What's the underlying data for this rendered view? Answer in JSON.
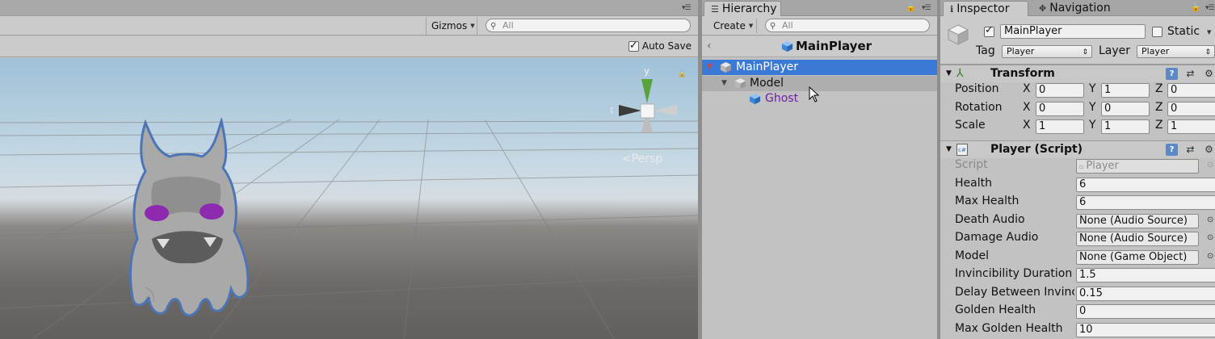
{
  "scene": {
    "gizmos_label": "Gizmos",
    "search_placeholder": "All",
    "autosave_label": "Auto Save",
    "autosave_checked": true,
    "persp_label": "Persp",
    "axis_y": "y",
    "axis_x": "x"
  },
  "hierarchy": {
    "tab_label": "Hierarchy",
    "create_label": "Create",
    "search_placeholder": "All",
    "scene_title": "MainPlayer",
    "tree": [
      {
        "label": "MainPlayer",
        "depth": 0,
        "selected": true,
        "expanded": true
      },
      {
        "label": "Model",
        "depth": 1,
        "selected": false,
        "expanded": true
      },
      {
        "label": "Ghost",
        "depth": 2,
        "selected": false,
        "prefab": true
      }
    ]
  },
  "inspector": {
    "tab_label": "Inspector",
    "nav_tab_label": "Navigation",
    "object_name": "MainPlayer",
    "active_checked": true,
    "static_label": "Static",
    "tag_label": "Tag",
    "tag_value": "Player",
    "layer_label": "Layer",
    "layer_value": "Player",
    "transform": {
      "title": "Transform",
      "rows": [
        {
          "label": "Position",
          "x": "0",
          "y": "1",
          "z": "0"
        },
        {
          "label": "Rotation",
          "x": "0",
          "y": "0",
          "z": "0"
        },
        {
          "label": "Scale",
          "x": "1",
          "y": "1",
          "z": "1"
        }
      ],
      "axis_x": "X",
      "axis_y": "Y",
      "axis_z": "Z"
    },
    "player_script": {
      "title": "Player (Script)",
      "script_label": "Script",
      "script_value": "Player",
      "props": [
        {
          "label": "Health",
          "value": "6",
          "kind": "value"
        },
        {
          "label": "Max Health",
          "value": "6",
          "kind": "value"
        },
        {
          "label": "Death Audio",
          "value": "None (Audio Source)",
          "kind": "object"
        },
        {
          "label": "Damage Audio",
          "value": "None (Audio Source)",
          "kind": "object"
        },
        {
          "label": "Model",
          "value": "None (Game Object)",
          "kind": "object"
        },
        {
          "label": "Invincibility Duration",
          "value": "1.5",
          "kind": "value"
        },
        {
          "label": "Delay Between Invinc",
          "value": "0.15",
          "kind": "value"
        },
        {
          "label": "Golden Health",
          "value": "0",
          "kind": "value"
        },
        {
          "label": "Max Golden Health",
          "value": "10",
          "kind": "value"
        }
      ]
    }
  },
  "colors": {
    "selection": "#3a7ad6",
    "prefab_text": "#6e1fa6",
    "panel_bg": "#c2c2c2"
  }
}
